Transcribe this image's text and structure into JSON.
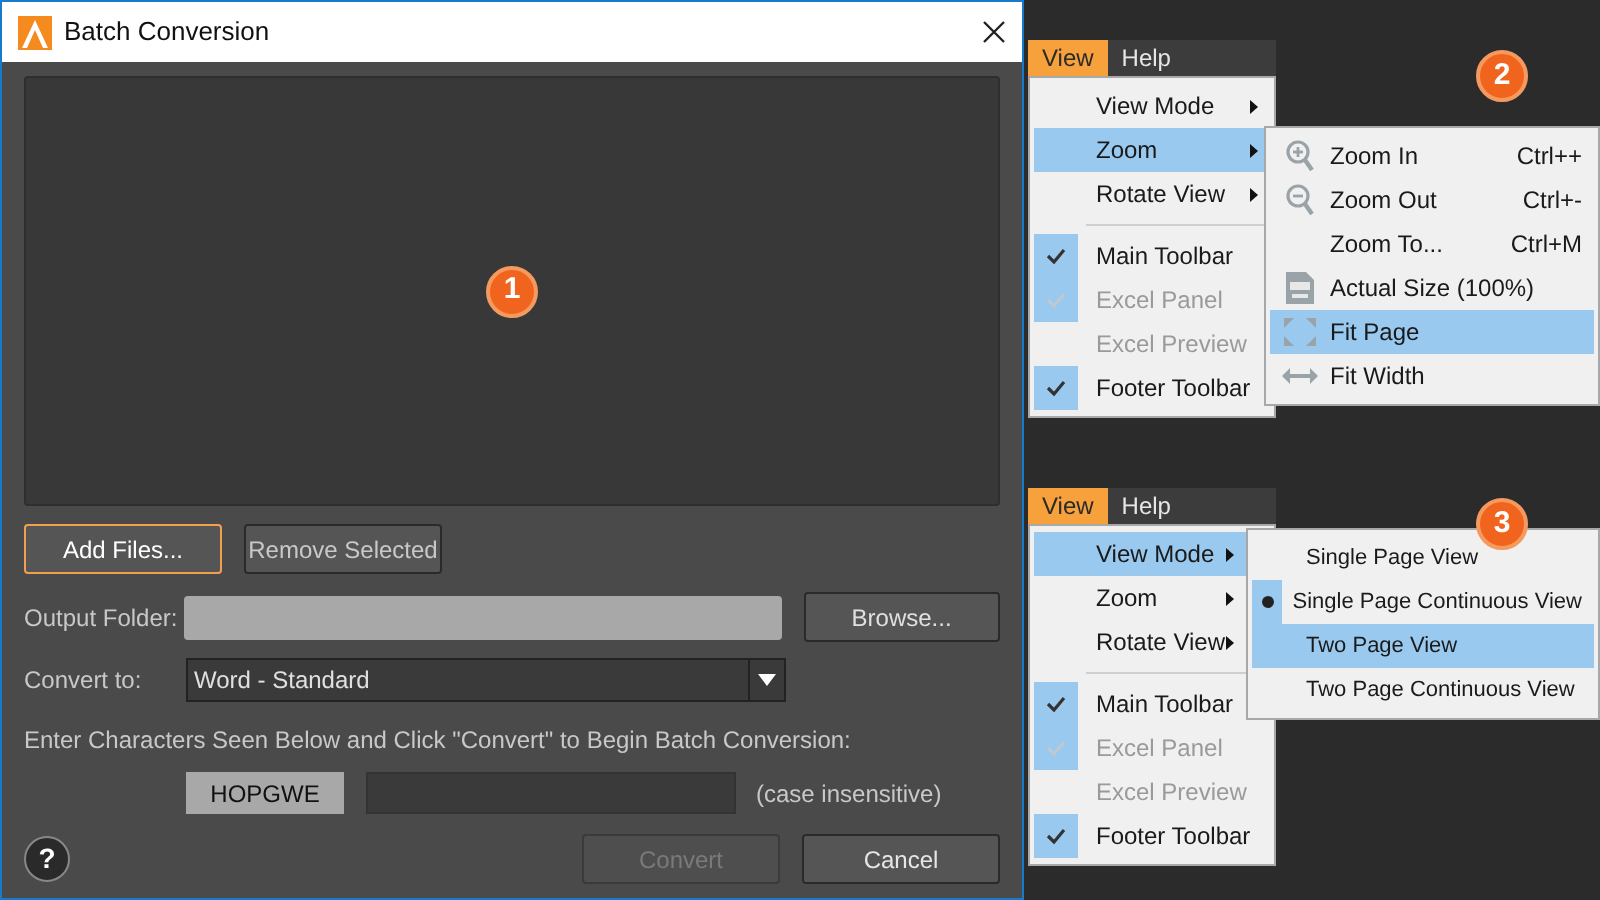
{
  "dialog": {
    "title": "Batch Conversion",
    "badge": "1",
    "add_button": "Add Files...",
    "remove_button": "Remove Selected",
    "output_label": "Output Folder:",
    "browse_button": "Browse...",
    "convert_label": "Convert to:",
    "convert_value": "Word - Standard",
    "instruction": "Enter Characters Seen Below and Click \"Convert\" to Begin Batch Conversion:",
    "captcha": "HOPGWE",
    "case_note": "(case insensitive)",
    "help": "?",
    "convert_button": {
      "label": "Convert",
      "disabled": true
    },
    "cancel_button": {
      "label": "Cancel",
      "disabled": false
    }
  },
  "menus": [
    {
      "badge": "2",
      "menubar": [
        {
          "label": "View",
          "selected": true
        },
        {
          "label": "Help",
          "selected": false
        }
      ],
      "items": [
        {
          "kind": "submenu",
          "label": "View Mode",
          "selected": false
        },
        {
          "kind": "submenu",
          "label": "Zoom",
          "selected": true
        },
        {
          "kind": "submenu",
          "label": "Rotate View",
          "selected": false
        },
        {
          "kind": "separator"
        },
        {
          "kind": "check",
          "label": "Main Toolbar",
          "checked": true,
          "disabled": false
        },
        {
          "kind": "check",
          "label": "Excel Panel",
          "checked": true,
          "disabled": true
        },
        {
          "kind": "check",
          "label": "Excel Preview",
          "checked": false,
          "disabled": true
        },
        {
          "kind": "check",
          "label": "Footer Toolbar",
          "checked": true,
          "disabled": false
        }
      ],
      "submenu": {
        "kind": "icons",
        "items": [
          {
            "kind": "zoom_in",
            "label": "Zoom In",
            "shortcut": "Ctrl++",
            "selected": false
          },
          {
            "kind": "zoom_out",
            "label": "Zoom Out",
            "shortcut": "Ctrl+-",
            "selected": false
          },
          {
            "kind": "plain",
            "label": "Zoom To...",
            "shortcut": "Ctrl+M",
            "selected": false
          },
          {
            "kind": "actual_size",
            "label": "Actual Size (100%)",
            "selected": false
          },
          {
            "kind": "fit_page",
            "label": "Fit Page",
            "selected": true
          },
          {
            "kind": "fit_width",
            "label": "Fit Width",
            "selected": false
          }
        ]
      }
    },
    {
      "badge": "3",
      "menubar": [
        {
          "label": "View",
          "selected": true
        },
        {
          "label": "Help",
          "selected": false
        }
      ],
      "items": [
        {
          "kind": "submenu",
          "label": "View Mode",
          "selected": true
        },
        {
          "kind": "submenu",
          "label": "Zoom",
          "selected": false
        },
        {
          "kind": "submenu",
          "label": "Rotate View",
          "selected": false
        },
        {
          "kind": "separator"
        },
        {
          "kind": "check",
          "label": "Main Toolbar",
          "checked": true,
          "disabled": false
        },
        {
          "kind": "check",
          "label": "Excel Panel",
          "checked": true,
          "disabled": true
        },
        {
          "kind": "check",
          "label": "Excel Preview",
          "checked": false,
          "disabled": true
        },
        {
          "kind": "check",
          "label": "Footer Toolbar",
          "checked": true,
          "disabled": false
        }
      ],
      "submenu": {
        "kind": "radios",
        "items": [
          {
            "label": "Single Page View",
            "checked": false,
            "selected": false
          },
          {
            "label": "Single Page Continuous View",
            "checked": true,
            "selected": false
          },
          {
            "label": "Two Page View",
            "checked": false,
            "selected": true
          },
          {
            "label": "Two Page Continuous View",
            "checked": false,
            "selected": false
          }
        ]
      }
    }
  ]
}
